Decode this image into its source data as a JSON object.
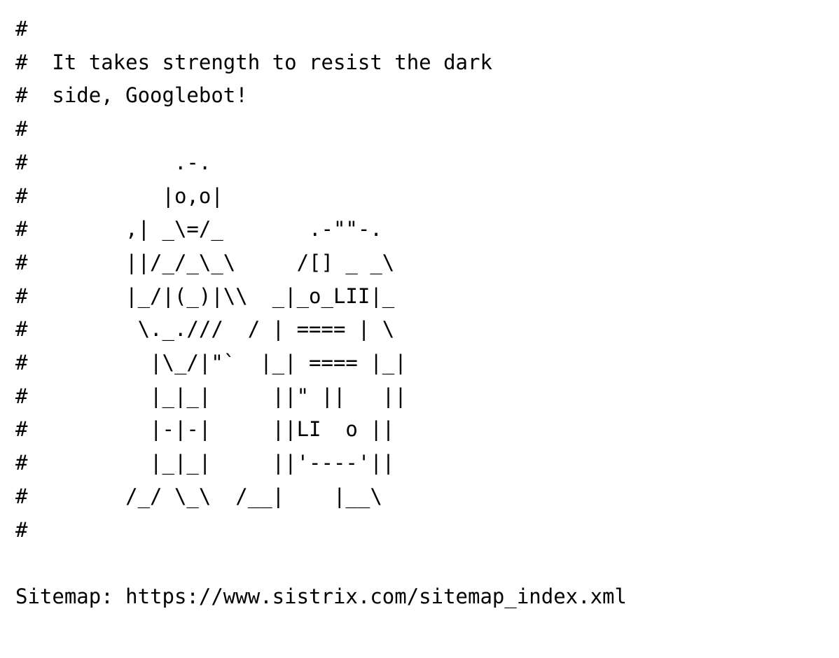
{
  "document": {
    "type": "plain-text-file",
    "file_kind": "robots.txt",
    "background_color": "#ffffff",
    "text_color": "#000000",
    "font_style": "monospace",
    "comment_char": "#",
    "message": {
      "line_1": "It takes strength to resist the dark",
      "line_2": "side, Googlebot!"
    },
    "ascii_art_title": "C-3PO and R2-D2 ASCII art",
    "lines": [
      "#",
      "#  It takes strength to resist the dark",
      "#  side, Googlebot!",
      "#",
      "#            .-.",
      "#           |o,o|",
      "#        ,| _\\=/_       .-\"\"-.",
      "#        ||/_/_\\_\\     /[] _ _\\",
      "#        |_/|(_)|\\\\  _|_o_LII|_",
      "#         \\._.///  / | ==== | \\",
      "#          |\\_/|\"`  |_| ==== |_|",
      "#          |_|_|     ||\" ||   ||",
      "#          |-|-|     ||LI  o ||",
      "#          |_|_|     ||'----'||",
      "#        /_/ \\_\\  /__|    |__\\",
      "#",
      "",
      "Sitemap: https://www.sistrix.com/sitemap_index.xml"
    ],
    "sitemap": {
      "directive": "Sitemap:",
      "url": "https://www.sistrix.com/sitemap_index.xml",
      "full_line": "Sitemap: https://www.sistrix.com/sitemap_index.xml"
    }
  }
}
